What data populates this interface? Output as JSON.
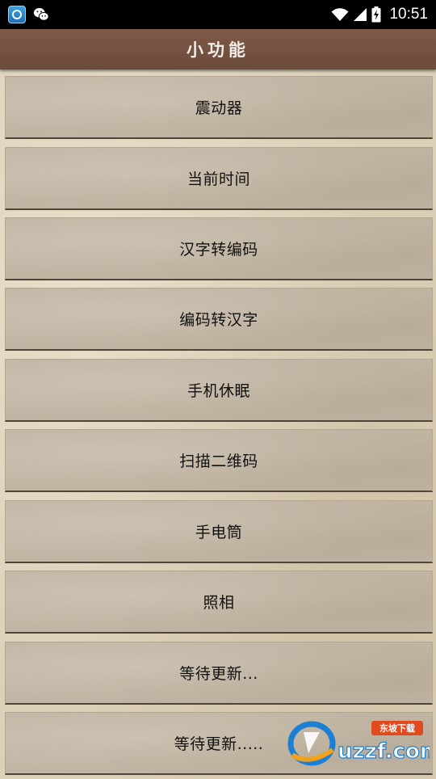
{
  "status_bar": {
    "time": "10:51",
    "icons": [
      "app-notification-icon",
      "wechat-icon",
      "wifi-icon",
      "signal-icon",
      "battery-charging-icon"
    ]
  },
  "title_bar": {
    "title": "小功能"
  },
  "menu": {
    "items": [
      {
        "label": "震动器"
      },
      {
        "label": "当前时间"
      },
      {
        "label": "汉字转编码"
      },
      {
        "label": "编码转汉字"
      },
      {
        "label": "手机休眠"
      },
      {
        "label": "扫描二维码"
      },
      {
        "label": "手电筒"
      },
      {
        "label": "照相"
      },
      {
        "label": "等待更新..."
      },
      {
        "label": "等待更新....."
      }
    ]
  },
  "watermark": {
    "brand": "uzzf.com",
    "tag": "东坡下载"
  },
  "colors": {
    "title_bar": "#73503f",
    "item_bg": "#c0b4a3",
    "page_bg": "#dcd0b8",
    "status_bar": "#000000"
  }
}
